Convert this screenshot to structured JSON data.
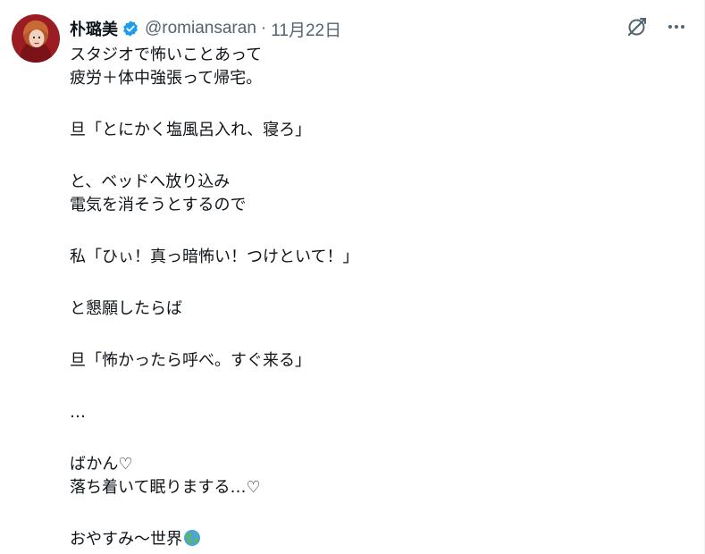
{
  "author": {
    "display_name": "朴璐美",
    "handle": "@romiansaran",
    "separator": "·",
    "date": "11月22日"
  },
  "icons": {
    "avatar": "profile-photo",
    "verified": "verified-badge-icon",
    "grok": "grok-icon",
    "more": "more-options-icon",
    "emoji": "globe-americas-emoji"
  },
  "colors": {
    "verified": "#1d9bf0",
    "secondary_text": "#536471",
    "avatar_bg": "#9b1c22"
  },
  "tweet": {
    "lines": [
      "スタジオで怖いことあって",
      "疲労＋体中強張って帰宅。",
      "旦「とにかく塩風呂入れ、寝ろ」",
      "と、ベッドへ放り込み",
      "電気を消そうとするので",
      "私「ひぃ！真っ暗怖い！つけといて！」",
      "と懇願したらば",
      "旦「怖かったら呼べ。すぐ来る」",
      "…",
      "ばかん♡",
      "落ち着いて眠りまする…♡",
      "おやすみ〜世界"
    ]
  }
}
